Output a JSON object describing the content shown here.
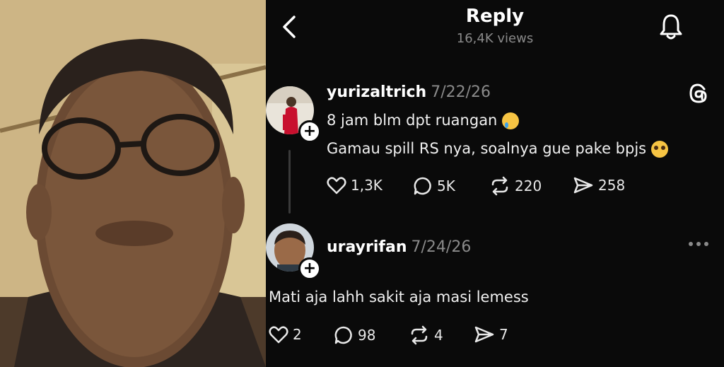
{
  "header": {
    "title": "Reply",
    "views": "16,4K views"
  },
  "posts": [
    {
      "username": "yurizaltrich",
      "date": "7/22/26",
      "lines": [
        "8 jam blm dpt ruangan",
        "Gamau spill RS nya, soalnya gue pake bpjs"
      ],
      "stats": {
        "likes": "1,3K",
        "replies": "5K",
        "reposts": "220",
        "shares": "258"
      }
    },
    {
      "username": "urayrifan",
      "date": "7/24/26",
      "lines": [
        "Mati aja lahh sakit aja masi lemess"
      ],
      "stats": {
        "likes": "2",
        "replies": "98",
        "reposts": "4",
        "shares": "7"
      }
    }
  ],
  "icons": [
    "back-icon",
    "bell-icon",
    "threads-logo-icon",
    "more-icon",
    "heart-icon",
    "comment-icon",
    "repost-icon",
    "share-icon",
    "plus-icon"
  ],
  "colors": {
    "background": "#0a0a0a",
    "text": "#f2f2f2",
    "muted": "#8a8a8a"
  }
}
